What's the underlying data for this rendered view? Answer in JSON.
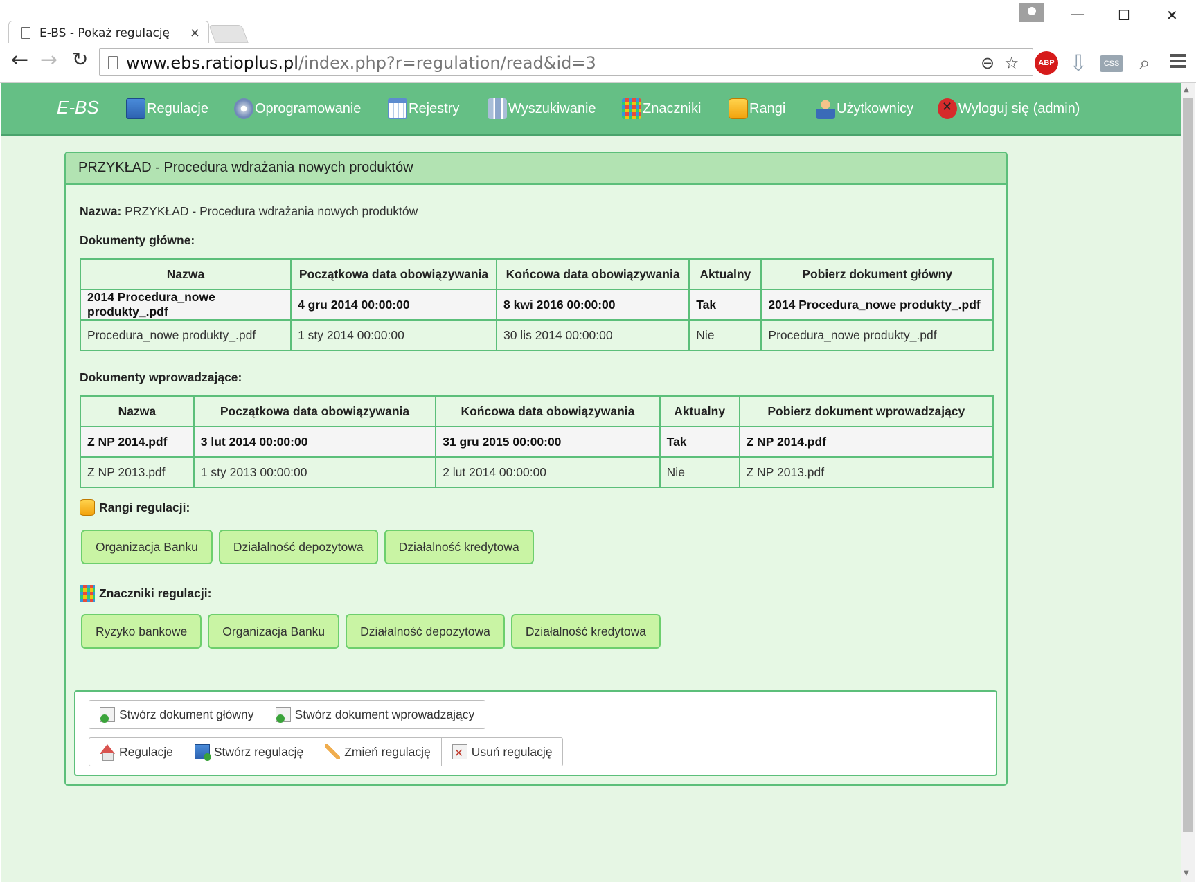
{
  "browser": {
    "tab_title": "E-BS - Pokaż regulację",
    "tab_close": "×",
    "url_host": "www.ebs.ratioplus.pl",
    "url_path": "/index.php?r=regulation/read&id=3",
    "abp_label": "ABP",
    "css_label": "CSS"
  },
  "nav": {
    "brand": "E-BS",
    "items": [
      {
        "label": "Regulacje",
        "icon": "book-icon"
      },
      {
        "label": "Oprogramowanie",
        "icon": "cd-icon"
      },
      {
        "label": "Rejestry",
        "icon": "calendar-icon"
      },
      {
        "label": "Wyszukiwanie",
        "icon": "binoculars-icon"
      },
      {
        "label": "Znaczniki",
        "icon": "tags-grid-icon"
      },
      {
        "label": "Rangi",
        "icon": "coins-icon"
      },
      {
        "label": "Użytkownicy",
        "icon": "user-icon"
      },
      {
        "label": "Wyloguj się (admin)",
        "icon": "logout-icon"
      }
    ]
  },
  "panel": {
    "title": "PRZYKŁAD - Procedura wdrażania nowych produktów",
    "name_label": "Nazwa:",
    "name_value": "PRZYKŁAD - Procedura wdrażania nowych produktów",
    "main_docs_label": "Dokumenty główne:",
    "main_docs": {
      "headers": [
        "Nazwa",
        "Początkowa data obowiązywania",
        "Końcowa data obowiązywania",
        "Aktualny",
        "Pobierz dokument główny"
      ],
      "rows": [
        [
          "2014 Procedura_nowe produkty_.pdf",
          "4 gru 2014 00:00:00",
          "8 kwi 2016 00:00:00",
          "Tak",
          "2014 Procedura_nowe produkty_.pdf"
        ],
        [
          "Procedura_nowe produkty_.pdf",
          "1 sty 2014 00:00:00",
          "30 lis 2014 00:00:00",
          "Nie",
          "Procedura_nowe produkty_.pdf"
        ]
      ]
    },
    "intro_docs_label": "Dokumenty wprowadzające:",
    "intro_docs": {
      "headers": [
        "Nazwa",
        "Początkowa data obowiązywania",
        "Końcowa data obowiązywania",
        "Aktualny",
        "Pobierz dokument wprowadzający"
      ],
      "rows": [
        [
          "Z NP 2014.pdf",
          "3 lut 2014 00:00:00",
          "31 gru 2015 00:00:00",
          "Tak",
          "Z NP 2014.pdf"
        ],
        [
          "Z NP 2013.pdf",
          "1 sty 2013 00:00:00",
          "2 lut 2014 00:00:00",
          "Nie",
          "Z NP 2013.pdf"
        ]
      ]
    },
    "ranks_label": "Rangi regulacji:",
    "ranks": [
      "Organizacja Banku",
      "Działalność depozytowa",
      "Działalność kredytowa"
    ],
    "tags_label": "Znaczniki regulacji:",
    "tags": [
      "Ryzyko bankowe",
      "Organizacja Banku",
      "Działalność depozytowa",
      "Działalność kredytowa"
    ]
  },
  "actions": {
    "create_main_doc": "Stwórz dokument główny",
    "create_intro_doc": "Stwórz dokument wprowadzający",
    "regulations": "Regulacje",
    "create_regulation": "Stwórz regulację",
    "edit_regulation": "Zmień regulację",
    "delete_regulation": "Usuń regulację"
  },
  "colors": {
    "navbar": "#65bf85",
    "page_bg": "#e6f6e4",
    "panel_head": "#b2e3b2",
    "tag_bg": "#c9f4a4",
    "border": "#5cbf7a"
  }
}
